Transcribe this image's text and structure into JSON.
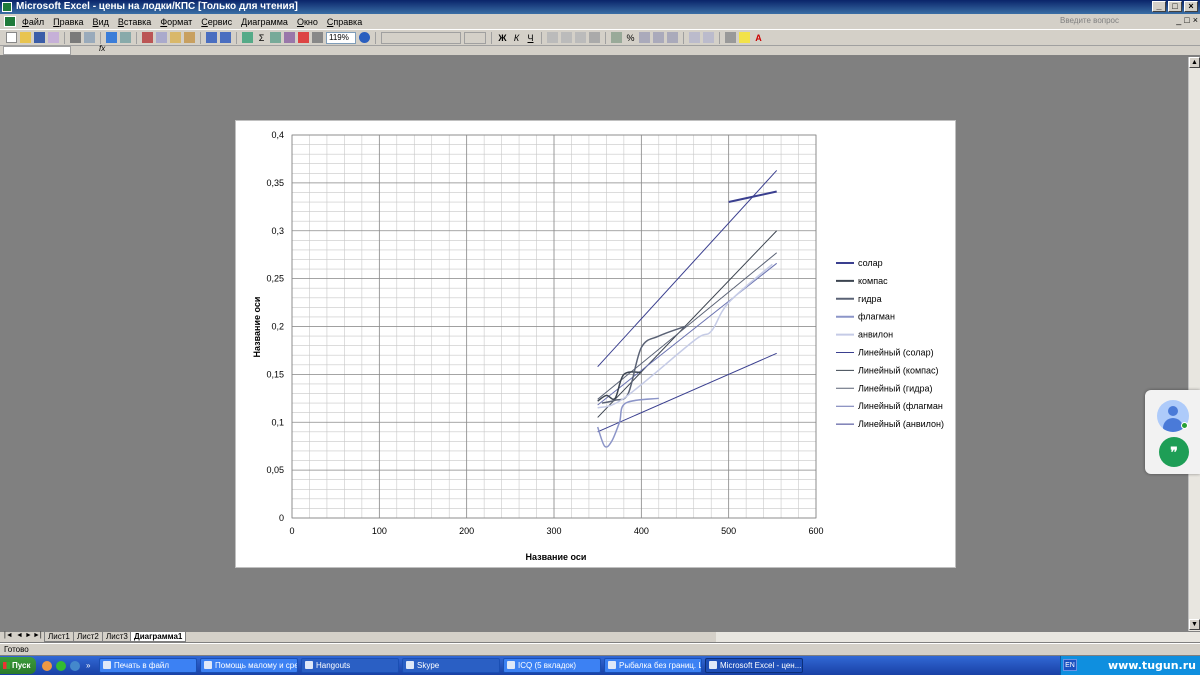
{
  "window": {
    "title": "Microsoft Excel - цены на лодки/КПС [Только для чтения]",
    "help_placeholder": "Введите вопрос"
  },
  "menu": [
    "Файл",
    "Правка",
    "Вид",
    "Вставка",
    "Формат",
    "Сервис",
    "Диаграмма",
    "Окно",
    "Справка"
  ],
  "toolbar": {
    "zoom": "119%",
    "format_buttons": [
      "Ж",
      "К",
      "Ч"
    ]
  },
  "formula_bar": {
    "fx_label": "fx"
  },
  "chart_data": {
    "type": "scatter",
    "xlabel": "Название оси",
    "ylabel": "Название оси",
    "xlim": [
      0,
      600
    ],
    "ylim": [
      0,
      0.4
    ],
    "x_ticks": [
      "0",
      "100",
      "200",
      "300",
      "400",
      "500",
      "600"
    ],
    "y_ticks": [
      "0",
      "0,05",
      "0,1",
      "0,15",
      "0,2",
      "0,25",
      "0,3",
      "0,35",
      "0,4"
    ],
    "grid": true,
    "legend_position": "right",
    "series": [
      {
        "name": "солар",
        "color": "#3a3f8f",
        "points": [
          [
            500,
            0.33
          ],
          [
            555,
            0.341
          ]
        ]
      },
      {
        "name": "компас",
        "color": "#3c4450",
        "points": [
          [
            350,
            0.122
          ],
          [
            360,
            0.128
          ],
          [
            370,
            0.125
          ],
          [
            380,
            0.15
          ],
          [
            400,
            0.152
          ]
        ]
      },
      {
        "name": "гидра",
        "color": "#5a6275",
        "points": [
          [
            355,
            0.12
          ],
          [
            370,
            0.123
          ],
          [
            385,
            0.13
          ],
          [
            400,
            0.178
          ],
          [
            420,
            0.19
          ],
          [
            450,
            0.2
          ]
        ]
      },
      {
        "name": "флагман",
        "color": "#8c95c8",
        "points": [
          [
            350,
            0.095
          ],
          [
            358,
            0.075
          ],
          [
            366,
            0.08
          ],
          [
            375,
            0.1
          ],
          [
            382,
            0.12
          ],
          [
            420,
            0.125
          ]
        ]
      },
      {
        "name": "анвилон",
        "color": "#c5cbe6",
        "points": [
          [
            350,
            0.115
          ],
          [
            380,
            0.125
          ],
          [
            460,
            0.185
          ],
          [
            480,
            0.195
          ],
          [
            500,
            0.225
          ],
          [
            550,
            0.265
          ]
        ]
      }
    ],
    "trendlines": [
      {
        "name": "Линейный (солар)",
        "color": "#3a3f8f",
        "from": [
          350,
          0.158
        ],
        "to": [
          555,
          0.363
        ]
      },
      {
        "name": "Линейный (компас)",
        "color": "#3c4450",
        "from": [
          350,
          0.105
        ],
        "to": [
          555,
          0.3
        ]
      },
      {
        "name": "Линейный (гидра)",
        "color": "#5a6275",
        "from": [
          350,
          0.124
        ],
        "to": [
          555,
          0.277
        ]
      },
      {
        "name": "Линейный (флагман",
        "color": "#6a72b0",
        "from": [
          350,
          0.118
        ],
        "to": [
          555,
          0.266
        ]
      },
      {
        "name": "Линейный (анвилон)",
        "color": "#3a3f8f",
        "from": [
          350,
          0.09
        ],
        "to": [
          555,
          0.172
        ]
      }
    ]
  },
  "sheet_tabs": [
    "Лист1",
    "Лист2",
    "Лист3",
    "Диаграмма1"
  ],
  "active_tab": "Диаграмма1",
  "status": "Готово",
  "taskbar": {
    "start": "Пуск",
    "buttons": [
      {
        "label": "Печать в файл",
        "active": false
      },
      {
        "label": "Помощь малому и сред...",
        "active": false
      },
      {
        "label": "Hangouts",
        "active": false
      },
      {
        "label": "Skype",
        "active": false
      },
      {
        "label": "ICQ (5 вкладок)",
        "active": false
      },
      {
        "label": "Рыбалка без границ. Ц...",
        "active": false
      },
      {
        "label": "Microsoft Excel - цен...",
        "active": true
      }
    ],
    "lang": "EN",
    "watermark": "www.tugun.ru"
  }
}
